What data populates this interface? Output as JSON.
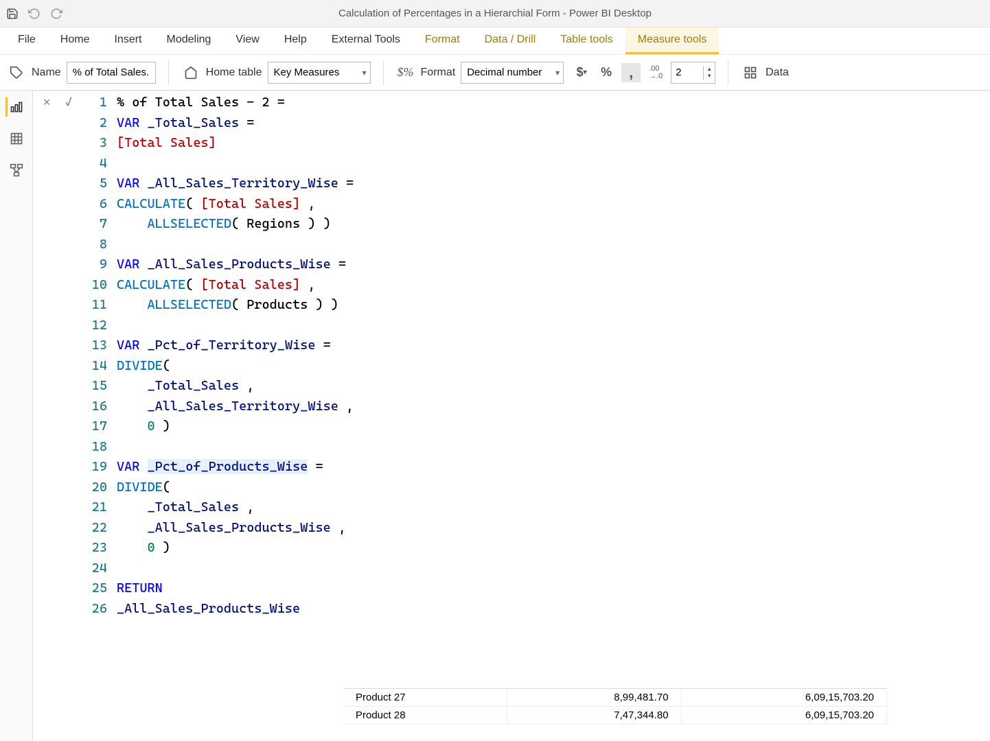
{
  "titlebar": {
    "title": "Calculation of Percentages in a Hierarchial Form - Power BI Desktop"
  },
  "ribbon": {
    "tabs": [
      "File",
      "Home",
      "Insert",
      "Modeling",
      "View",
      "Help",
      "External Tools",
      "Format",
      "Data / Drill",
      "Table tools",
      "Measure tools"
    ]
  },
  "toolbar": {
    "name_label": "Name",
    "name_value": "% of Total Sales...",
    "home_table_label": "Home table",
    "home_table_value": "Key Measures",
    "format_label": "Format",
    "format_value": "Decimal number",
    "decimals_value": "2",
    "data_cat_label": "Data"
  },
  "code": {
    "lines": [
      {
        "n": 1,
        "tokens": [
          {
            "t": "% of Total Sales - 2 ",
            "c": ""
          },
          {
            "t": "=",
            "c": "op"
          }
        ]
      },
      {
        "n": 2,
        "tokens": [
          {
            "t": "VAR",
            "c": "kw"
          },
          {
            "t": " ",
            "c": ""
          },
          {
            "t": "_Total_Sales",
            "c": "vr"
          },
          {
            "t": " =",
            "c": ""
          }
        ]
      },
      {
        "n": 3,
        "tokens": [
          {
            "t": "[Total Sales]",
            "c": "meas"
          }
        ]
      },
      {
        "n": 4,
        "tokens": [
          {
            "t": "",
            "c": ""
          }
        ]
      },
      {
        "n": 5,
        "tokens": [
          {
            "t": "VAR",
            "c": "kw"
          },
          {
            "t": " ",
            "c": ""
          },
          {
            "t": "_All_Sales_Territory_Wise",
            "c": "vr"
          },
          {
            "t": " =",
            "c": ""
          }
        ]
      },
      {
        "n": 6,
        "tokens": [
          {
            "t": "CALCULATE",
            "c": "fn"
          },
          {
            "t": "( ",
            "c": ""
          },
          {
            "t": "[Total Sales]",
            "c": "meas"
          },
          {
            "t": " ,",
            "c": ""
          }
        ]
      },
      {
        "n": 7,
        "tokens": [
          {
            "t": "    ",
            "c": ""
          },
          {
            "t": "ALLSELECTED",
            "c": "fn"
          },
          {
            "t": "( Regions ) )",
            "c": ""
          }
        ]
      },
      {
        "n": 8,
        "tokens": [
          {
            "t": "",
            "c": ""
          }
        ]
      },
      {
        "n": 9,
        "tokens": [
          {
            "t": "VAR",
            "c": "kw"
          },
          {
            "t": " ",
            "c": ""
          },
          {
            "t": "_All_Sales_Products_Wise",
            "c": "vr"
          },
          {
            "t": " =",
            "c": ""
          }
        ]
      },
      {
        "n": 10,
        "tokens": [
          {
            "t": "CALCULATE",
            "c": "fn"
          },
          {
            "t": "( ",
            "c": ""
          },
          {
            "t": "[Total Sales]",
            "c": "meas"
          },
          {
            "t": " ,",
            "c": ""
          }
        ]
      },
      {
        "n": 11,
        "tokens": [
          {
            "t": "    ",
            "c": ""
          },
          {
            "t": "ALLSELECTED",
            "c": "fn"
          },
          {
            "t": "( Products ) )",
            "c": ""
          }
        ]
      },
      {
        "n": 12,
        "tokens": [
          {
            "t": "",
            "c": ""
          }
        ]
      },
      {
        "n": 13,
        "tokens": [
          {
            "t": "VAR",
            "c": "kw"
          },
          {
            "t": " ",
            "c": ""
          },
          {
            "t": "_Pct_of_Territory_Wise",
            "c": "vr"
          },
          {
            "t": " =",
            "c": ""
          }
        ]
      },
      {
        "n": 14,
        "tokens": [
          {
            "t": "DIVIDE",
            "c": "fn"
          },
          {
            "t": "(",
            "c": ""
          }
        ]
      },
      {
        "n": 15,
        "tokens": [
          {
            "t": "    ",
            "c": ""
          },
          {
            "t": "_Total_Sales",
            "c": "vr"
          },
          {
            "t": " ,",
            "c": ""
          }
        ]
      },
      {
        "n": 16,
        "tokens": [
          {
            "t": "    ",
            "c": ""
          },
          {
            "t": "_All_Sales_Territory_Wise",
            "c": "vr"
          },
          {
            "t": " ,",
            "c": ""
          }
        ]
      },
      {
        "n": 17,
        "tokens": [
          {
            "t": "    ",
            "c": ""
          },
          {
            "t": "0",
            "c": "num"
          },
          {
            "t": " )",
            "c": ""
          }
        ]
      },
      {
        "n": 18,
        "tokens": [
          {
            "t": "",
            "c": ""
          }
        ]
      },
      {
        "n": 19,
        "tokens": [
          {
            "t": "VAR",
            "c": "kw"
          },
          {
            "t": " ",
            "c": ""
          },
          {
            "t": "_Pct_of_Products_Wise",
            "c": "vr hl"
          },
          {
            "t": " =",
            "c": ""
          }
        ]
      },
      {
        "n": 20,
        "tokens": [
          {
            "t": "DIVIDE",
            "c": "fn"
          },
          {
            "t": "(",
            "c": ""
          }
        ]
      },
      {
        "n": 21,
        "tokens": [
          {
            "t": "    ",
            "c": ""
          },
          {
            "t": "_Total_Sales",
            "c": "vr"
          },
          {
            "t": " ,",
            "c": ""
          }
        ]
      },
      {
        "n": 22,
        "tokens": [
          {
            "t": "    ",
            "c": ""
          },
          {
            "t": "_All_Sales_Products_Wise",
            "c": "vr"
          },
          {
            "t": " ,",
            "c": ""
          }
        ]
      },
      {
        "n": 23,
        "tokens": [
          {
            "t": "    ",
            "c": ""
          },
          {
            "t": "0",
            "c": "num"
          },
          {
            "t": " )",
            "c": ""
          }
        ]
      },
      {
        "n": 24,
        "tokens": [
          {
            "t": "",
            "c": ""
          }
        ]
      },
      {
        "n": 25,
        "tokens": [
          {
            "t": "RETURN",
            "c": "kw"
          }
        ]
      },
      {
        "n": 26,
        "tokens": [
          {
            "t": "_All_Sales_Products_Wise",
            "c": "vr"
          }
        ]
      }
    ]
  },
  "table_peek": {
    "rows": [
      {
        "label": "Product 27",
        "v1": "8,99,481.70",
        "v2": "6,09,15,703.20"
      },
      {
        "label": "Product 28",
        "v1": "7,47,344.80",
        "v2": "6,09,15,703.20"
      }
    ]
  }
}
